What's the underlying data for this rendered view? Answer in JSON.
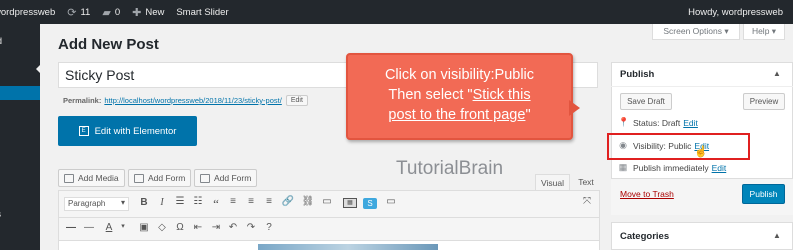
{
  "admin_bar": {
    "site_name": "wordpressweb",
    "updates_count": "11",
    "comments_count": "0",
    "new_label": "New",
    "smart_slider_label": "Smart Slider",
    "howdy": "Howdy, wordpressweb"
  },
  "admin_menu": {
    "items": [
      "rd",
      "ts",
      "s"
    ]
  },
  "screen_meta": {
    "screen_options": "Screen Options ▾",
    "help": "Help ▾"
  },
  "page": {
    "title": "Add New Post"
  },
  "post": {
    "title_value": "Sticky Post",
    "permalink_label": "Permalink:",
    "permalink_url": "http://localhost/wordpressweb/2018/11/23/sticky-post/",
    "permalink_edit": "Edit"
  },
  "elementor": {
    "button_label": "Edit with Elementor"
  },
  "media_buttons": {
    "add_media": "Add Media",
    "add_form_1": "Add Form",
    "add_form_2": "Add Form"
  },
  "editor": {
    "tab_visual": "Visual",
    "tab_text": "Text",
    "format_select": "Paragraph"
  },
  "watermark": "TutorialBrain",
  "callout": {
    "line1": "Click on  visibility:Public",
    "line2_prefix": "Then select \"",
    "line2_link": "Stick this",
    "line3_link": "post to the front page",
    "line3_suffix": "\""
  },
  "publish_box": {
    "title": "Publish",
    "save_draft": "Save Draft",
    "preview": "Preview",
    "status_label": "Status: Draft",
    "status_edit": "Edit",
    "visibility_label": "Visibility: Public",
    "visibility_edit": "Edit",
    "publish_label": "Publish immediately",
    "publish_edit": "Edit",
    "move_to_trash": "Move to Trash",
    "publish_button": "Publish"
  },
  "categories_box": {
    "title": "Categories"
  },
  "colors": {
    "admin_bar": "#23282d",
    "primary_blue": "#0073aa",
    "callout": "#f26a55",
    "highlight_border": "#e02020"
  }
}
